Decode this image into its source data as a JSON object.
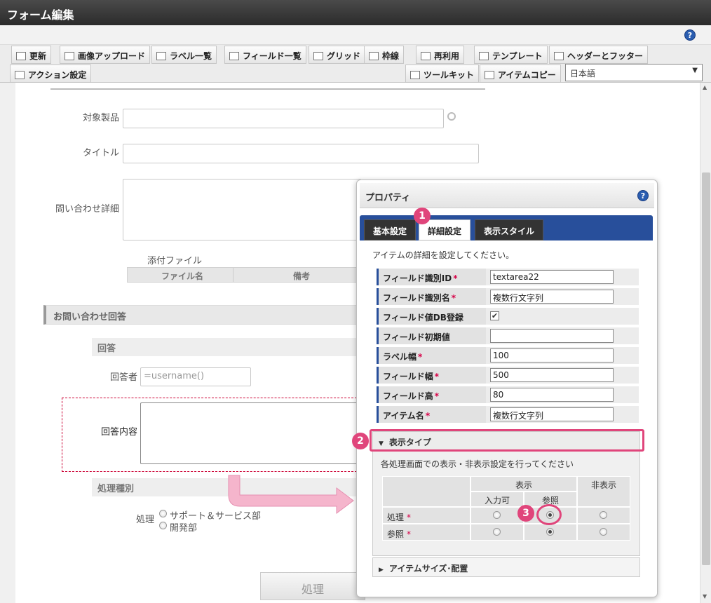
{
  "window": {
    "title": "フォーム編集"
  },
  "toolbar": {
    "row1": [
      {
        "label": "更新",
        "icon": "update-icon"
      },
      {
        "label": "画像アップロード",
        "icon": "image-upload-icon"
      },
      {
        "label": "ラベル一覧",
        "icon": "label-list-icon"
      },
      {
        "label": "フィールド一覧",
        "icon": "field-list-icon"
      },
      {
        "label": "グリッド",
        "icon": "grid-icon"
      },
      {
        "label": "枠線",
        "icon": "border-icon"
      },
      {
        "label": "再利用",
        "icon": "reuse-icon"
      },
      {
        "label": "テンプレート",
        "icon": "template-icon"
      },
      {
        "label": "ヘッダーとフッター",
        "icon": "header-footer-icon"
      }
    ],
    "action_label": "アクション設定",
    "toolkit_label": "ツールキット",
    "item_copy_label": "アイテムコピー",
    "language": "日本語"
  },
  "form": {
    "target_product_label": "対象製品",
    "title_label": "タイトル",
    "inquiry_detail_label": "問い合わせ詳細",
    "attachment_label": "添付ファイル",
    "attachment_cols": [
      "ファイル名",
      "備考"
    ],
    "answer_section_title": "お問い合わせ回答",
    "answer_sub_title": "回答",
    "answerer_label": "回答者",
    "answerer_value": "=username()",
    "answer_content_label": "回答内容",
    "process_type_title": "処理種別",
    "process_label": "処理",
    "process_options": [
      "サポート＆サービス部",
      "開発部"
    ],
    "process_button": "処理"
  },
  "properties": {
    "title": "プロパティ",
    "tabs": [
      "基本設定",
      "詳細設定",
      "表示スタイル"
    ],
    "description": "アイテムの詳細を設定してください。",
    "rows": [
      {
        "label": "フィールド識別ID",
        "required": true,
        "value": "textarea22"
      },
      {
        "label": "フィールド識別名",
        "required": true,
        "value": "複数行文字列"
      },
      {
        "label": "フィールド値DB登録",
        "required": false,
        "checked": true
      },
      {
        "label": "フィールド初期値",
        "required": false,
        "value": ""
      },
      {
        "label": "ラベル幅",
        "required": true,
        "value": "100"
      },
      {
        "label": "フィールド幅",
        "required": true,
        "value": "500"
      },
      {
        "label": "フィールド高",
        "required": true,
        "value": "80"
      },
      {
        "label": "アイテム名",
        "required": true,
        "value": "複数行文字列"
      }
    ],
    "required_mark": "*",
    "display_type": {
      "title": "表示タイプ",
      "description": "各処理画面での表示・非表示設定を行ってください",
      "col_show": "表示",
      "col_hide": "非表示",
      "col_input": "入力可",
      "col_ref": "参照",
      "rows": [
        {
          "label": "処理",
          "selected": "ref"
        },
        {
          "label": "参照",
          "selected": "ref"
        }
      ]
    },
    "item_size_title": "アイテムサイズ･配置"
  },
  "steps": [
    "1",
    "2",
    "3"
  ],
  "colors": {
    "accent": "#e0457b",
    "tab_bar": "#284f9b"
  }
}
